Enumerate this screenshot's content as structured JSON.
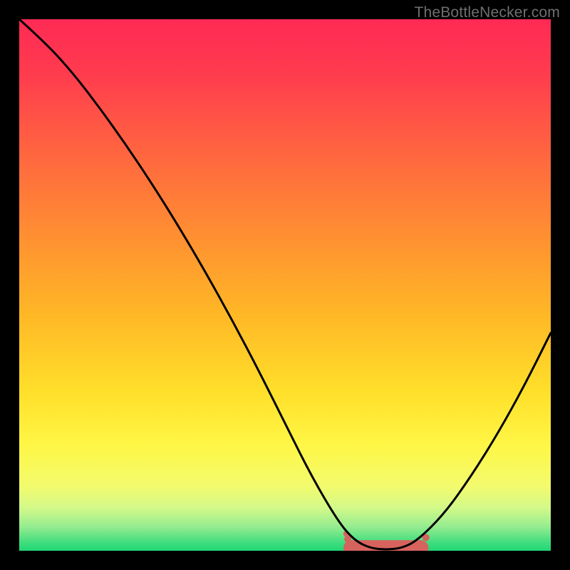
{
  "watermark": "TheBottleNecker.com",
  "chart_data": {
    "type": "line",
    "title": "",
    "xlabel": "",
    "ylabel": "",
    "xlim": [
      0,
      100
    ],
    "ylim": [
      0,
      100
    ],
    "series": [
      {
        "name": "curve",
        "x": [
          0,
          5,
          10,
          15,
          20,
          25,
          30,
          35,
          40,
          45,
          50,
          55,
          60,
          63,
          66,
          69,
          72,
          75,
          80,
          85,
          90,
          95,
          100
        ],
        "y": [
          100,
          95.5,
          90,
          83.5,
          76.5,
          69,
          61,
          52.5,
          43.5,
          34,
          24,
          14,
          5.5,
          2,
          0.5,
          0.2,
          0.5,
          2,
          7,
          14,
          22,
          31,
          41
        ],
        "color": "#000000",
        "stroke_width": 3
      }
    ],
    "highlight": {
      "color": "#d6635d",
      "band": {
        "x_start": 61,
        "x_end": 77,
        "y": 0.5,
        "height": 1.5
      },
      "dots": [
        {
          "x": 61.5,
          "y": 3.2,
          "r": 4
        },
        {
          "x": 61.8,
          "y": 2.2,
          "r": 5
        },
        {
          "x": 62.4,
          "y": 1.3,
          "r": 5
        },
        {
          "x": 76.5,
          "y": 2.5,
          "r": 5
        }
      ]
    },
    "background_gradient": {
      "type": "vertical",
      "stops": [
        {
          "offset": 0.0,
          "color": "#ff2a54"
        },
        {
          "offset": 0.1,
          "color": "#ff3b4e"
        },
        {
          "offset": 0.25,
          "color": "#ff6540"
        },
        {
          "offset": 0.4,
          "color": "#ff8d32"
        },
        {
          "offset": 0.55,
          "color": "#ffb626"
        },
        {
          "offset": 0.7,
          "color": "#ffdf2a"
        },
        {
          "offset": 0.8,
          "color": "#fff645"
        },
        {
          "offset": 0.88,
          "color": "#f2fb6e"
        },
        {
          "offset": 0.92,
          "color": "#d2f989"
        },
        {
          "offset": 0.955,
          "color": "#94ec90"
        },
        {
          "offset": 0.985,
          "color": "#3fdd7e"
        },
        {
          "offset": 1.0,
          "color": "#21d774"
        }
      ]
    }
  }
}
